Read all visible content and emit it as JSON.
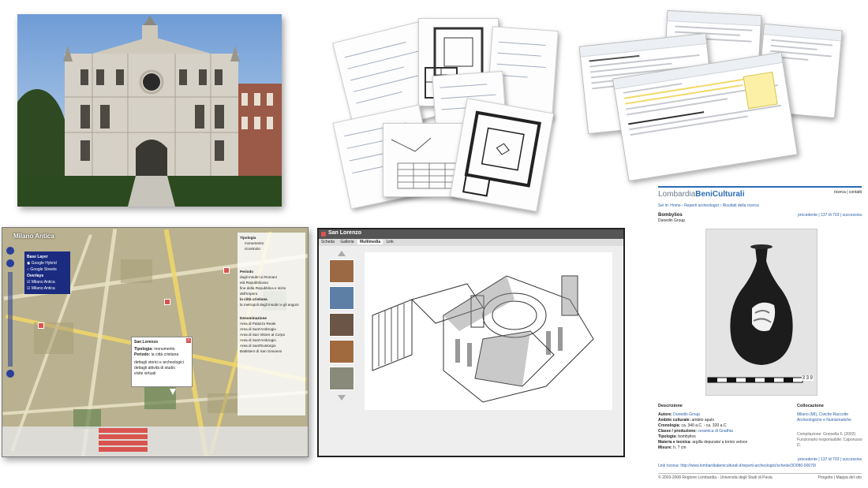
{
  "map": {
    "title": "Milano Antica",
    "base_layer": "Base Layer",
    "layers": [
      "Google Hybrid",
      "Google Streets"
    ],
    "overlays": "Overlays",
    "overlay_items": [
      "Milano Antica",
      "Milano Antica"
    ],
    "popup": {
      "title": "San Lorenzo",
      "tipologia_label": "Tipologia:",
      "tipologia_value": "monumento",
      "periodo_label": "Periodo:",
      "periodo_value": "la città cristiana",
      "links": [
        "dettagli storici e archeologici",
        "dettagli attività di studio",
        "visite virtuali"
      ]
    },
    "filter": {
      "tipologia_title": "Tipologia",
      "tipologia_items": [
        "monumento",
        "ricostruito"
      ],
      "periodo_title": "Periodo",
      "periodo_items": [
        "dagli Insubri ai Romani",
        "età Repubblicana",
        "fine della Repubblica e inizio dell'Impero",
        "la città cristiana",
        "la metropoli degli Insubri e gli angoni"
      ],
      "denominazione_title": "Denominazione",
      "denominazione_items": [
        "Area di Palazzo Reale",
        "Area di Sant'Ambrogio",
        "Area di San Vittore al Corpo",
        "Area di Sant'Ambrogio",
        "Area di Sant'Eustorgio",
        "Battistero di San Giovanni"
      ]
    }
  },
  "app": {
    "title": "San Lorenzo",
    "tabs": [
      "Scheda",
      "Galleria",
      "Multimedia",
      "Link"
    ]
  },
  "catalog": {
    "brand_a": "Lombardia",
    "brand_b": "BeniCulturali",
    "top_links": "ricerca | contatti",
    "breadcrumb": "Sei in: Home › Reperti archeologici › Risultati della ricerca",
    "item_title": "Bombylios",
    "item_subtitle": "Dunedin Group",
    "nav": "precedente | 137 di 703 | successiva",
    "descrizione_title": "Descrizione",
    "fields": [
      {
        "label": "Autore:",
        "value": "Dunedin Group"
      },
      {
        "label": "Ambito culturale:",
        "value": "ambito apulo"
      },
      {
        "label": "Cronologia:",
        "value": "ca. 340 a.C. - ca. 320 a.C."
      },
      {
        "label": "Classe / produzione:",
        "value": "ceramica di Gnathia"
      },
      {
        "label": "Tipologia:",
        "value": "bombylios"
      },
      {
        "label": "Materia e tecnica:",
        "value": "argilla depurata/ a tornio veloce"
      },
      {
        "label": "Misure:",
        "value": "h. 7 cm"
      }
    ],
    "collocazione_title": "Collocazione",
    "collocazione_text": "Milano (MI), Civiche Raccolte Archeologiche e Numismatiche",
    "compilazione": "Compilazione: Gonnella F. (2002)",
    "funzionario": "Funzionario responsabile: Caporusso D.",
    "nav_bottom": "precedente | 137 di 703 | successiva",
    "link_risorsa": "Link risorsa: http://www.lombardiabeniculturali.it/reperti-archeologici/schede/3O080-00079/",
    "footer_left": "© 2003-2008 Regione Lombardia - Università degli Studi di Pavia",
    "footer_right": "Progetto | Mappa del sito",
    "ruler": "3 3 9"
  },
  "colors": {
    "map_popup_red": "#d9544f",
    "map_layer_panel": "#1a2b80",
    "catalog_brand_blue": "#2a6bb3",
    "catalog_link": "#2a5fa8"
  }
}
